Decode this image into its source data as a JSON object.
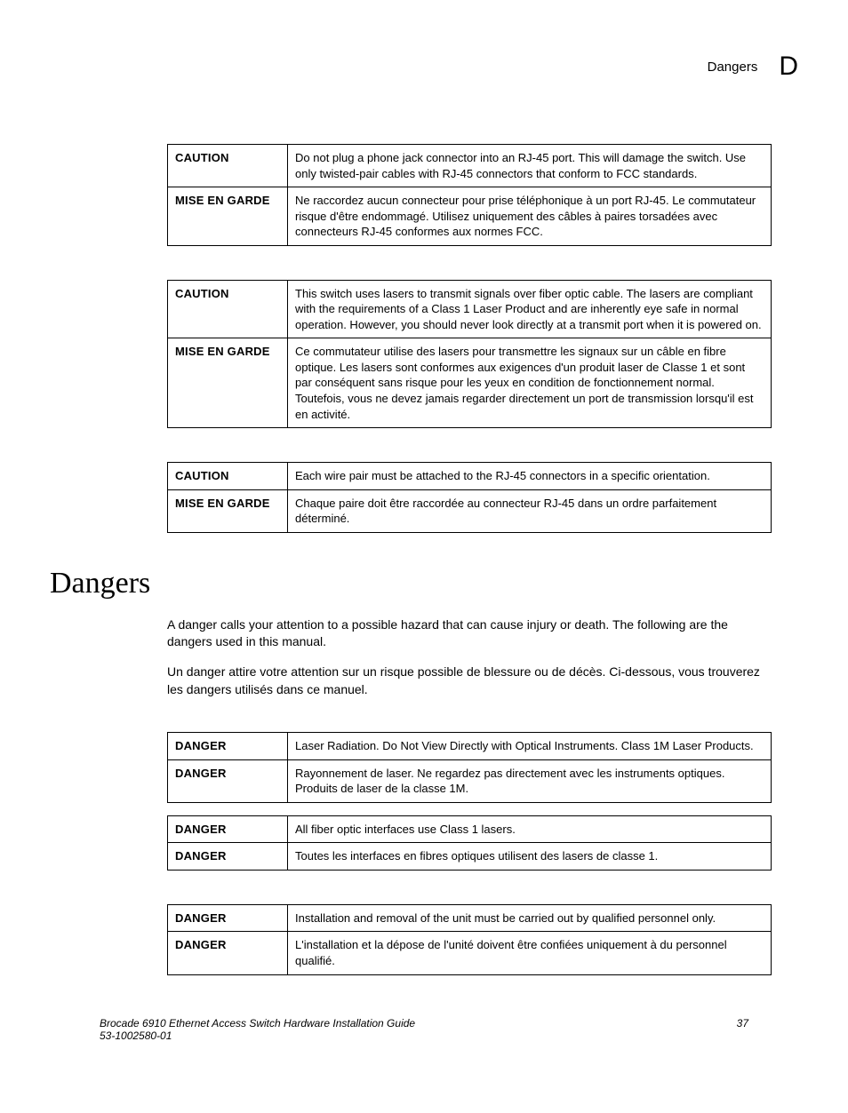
{
  "header": {
    "text": "Dangers",
    "letter": "D"
  },
  "tables": {
    "caution1": {
      "r1_label": "CAUTION",
      "r1_text": "Do not plug a phone jack connector into an RJ-45 port. This will damage the switch. Use only twisted-pair cables with RJ-45 connectors that conform to FCC standards.",
      "r2_label": "MISE EN GARDE",
      "r2_text": "Ne raccordez aucun connecteur pour prise téléphonique à un port RJ-45. Le commutateur risque d'être endommagé. Utilisez uniquement des câbles à paires torsadées avec connecteurs RJ-45 conformes aux normes FCC."
    },
    "caution2": {
      "r1_label": "CAUTION",
      "r1_text": "This switch uses lasers to transmit signals over fiber optic cable. The lasers are compliant with the requirements of a Class 1 Laser Product and are inherently eye safe in normal operation. However, you should never look directly at a transmit port when it is powered on.",
      "r2_label": "MISE EN GARDE",
      "r2_text": "Ce commutateur utilise des lasers pour transmettre les signaux sur un câble en fibre optique. Les lasers sont conformes aux exigences d'un produit laser de Classe 1 et sont par conséquent sans risque pour les yeux en condition de fonctionnement normal. Toutefois, vous ne devez jamais regarder directement un port de transmission lorsqu'il est en activité."
    },
    "caution3": {
      "r1_label": "CAUTION",
      "r1_text": "Each wire pair must be attached to the RJ-45 connectors in a specific orientation.",
      "r2_label": "MISE EN GARDE",
      "r2_text": "Chaque paire doit être raccordée au connecteur RJ-45 dans un ordre parfaitement déterminé."
    },
    "danger1": {
      "r1_label": "DANGER",
      "r1_text": "Laser Radiation. Do Not View Directly with Optical Instruments. Class 1M Laser Products.",
      "r2_label": "DANGER",
      "r2_text": "Rayonnement de laser. Ne regardez pas directement avec les instruments optiques. Produits de laser de la classe 1M."
    },
    "danger2": {
      "r1_label": "DANGER",
      "r1_text": "All fiber optic interfaces use Class 1 lasers.",
      "r2_label": "DANGER",
      "r2_text": "Toutes les interfaces en fibres optiques utilisent des lasers de classe 1."
    },
    "danger3": {
      "r1_label": "DANGER",
      "r1_text": "Installation and removal of the unit must be carried out by qualified personnel only.",
      "r2_label": "DANGER",
      "r2_text": "L'installation et la dépose de l'unité doivent être confiées uniquement à du personnel qualifié."
    }
  },
  "section_title": "Dangers",
  "intro1": "A danger calls your attention to a possible hazard that can cause injury or death. The following are the dangers used in this manual.",
  "intro2": "Un danger attire votre attention sur un risque possible de blessure ou de décès. Ci-dessous, vous trouverez les dangers utilisés dans ce manuel.",
  "footer": {
    "left1": "Brocade 6910 Ethernet Access Switch Hardware Installation Guide",
    "left2": "53-1002580-01",
    "right": "37"
  }
}
